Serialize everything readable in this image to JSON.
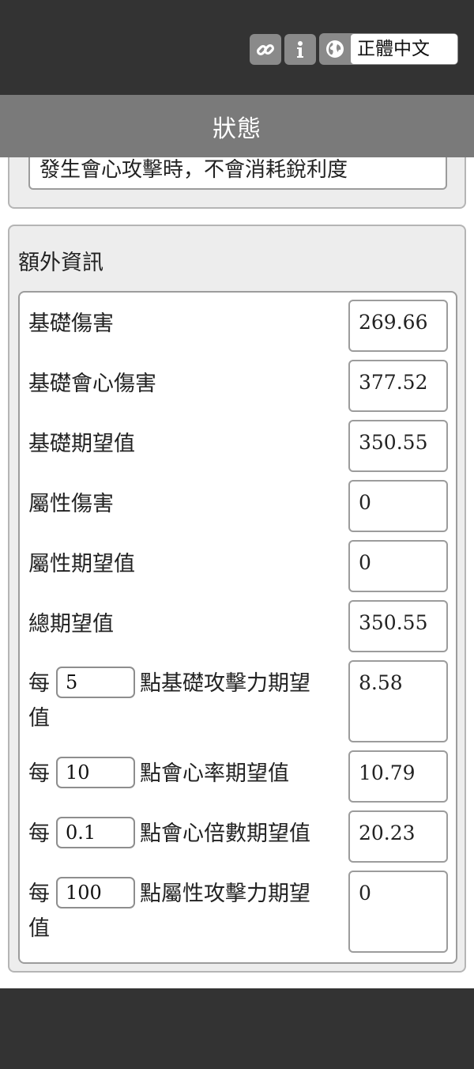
{
  "header": {
    "language": "正體中文",
    "icons": [
      "link-icon",
      "info-icon",
      "globe-icon"
    ]
  },
  "title": "狀態",
  "prev_section": {
    "text": "發生會心攻擊時，不會消耗銳利度"
  },
  "extra_info": {
    "heading": "額外資訊",
    "rows": [
      {
        "label": "基礎傷害",
        "value": "269.66"
      },
      {
        "label": "基礎會心傷害",
        "value": "377.52"
      },
      {
        "label": "基礎期望值",
        "value": "350.55"
      },
      {
        "label": "屬性傷害",
        "value": "0"
      },
      {
        "label": "屬性期望值",
        "value": "0"
      },
      {
        "label": "總期望值",
        "value": "350.55"
      }
    ],
    "per_rows": [
      {
        "prefix": "每",
        "input": "5",
        "suffix": "點基礎攻擊力期望值",
        "value": "8.58"
      },
      {
        "prefix": "每",
        "input": "10",
        "suffix": "點會心率期望值",
        "value": "10.79"
      },
      {
        "prefix": "每",
        "input": "0.1",
        "suffix": "點會心倍數期望值",
        "value": "20.23"
      },
      {
        "prefix": "每",
        "input": "100",
        "suffix": "點屬性攻擊力期望值",
        "value": "0"
      }
    ]
  },
  "colors": {
    "topbar": "#333333",
    "titlebar": "#7a7a7a",
    "panel": "#ededed",
    "border": "#9c9c9c"
  }
}
